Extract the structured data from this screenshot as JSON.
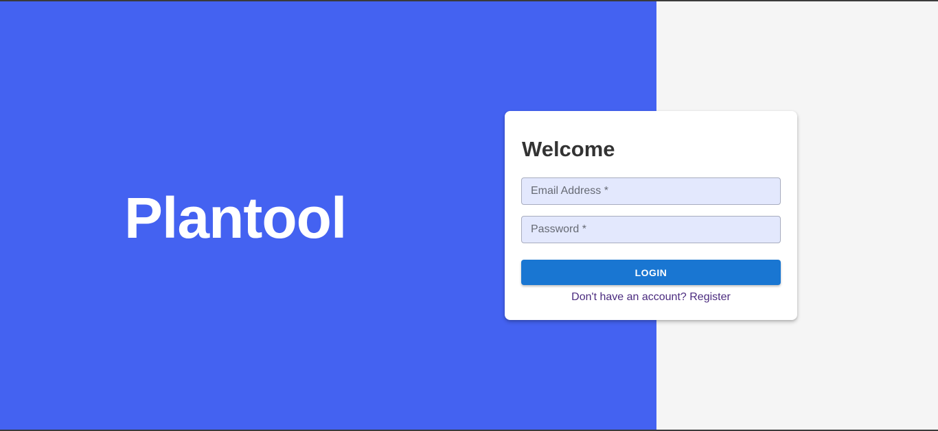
{
  "brand": {
    "name": "Plantool"
  },
  "login_card": {
    "title": "Welcome",
    "email_placeholder": "Email Address *",
    "password_placeholder": "Password *",
    "login_label": "LOGIN",
    "register_text": "Don't have an account? Register"
  },
  "colors": {
    "left_panel": "#4462f1",
    "right_panel": "#f5f5f5",
    "button": "#1976d2",
    "input_background": "#e3e8fd",
    "link": "#4a2a7e"
  }
}
